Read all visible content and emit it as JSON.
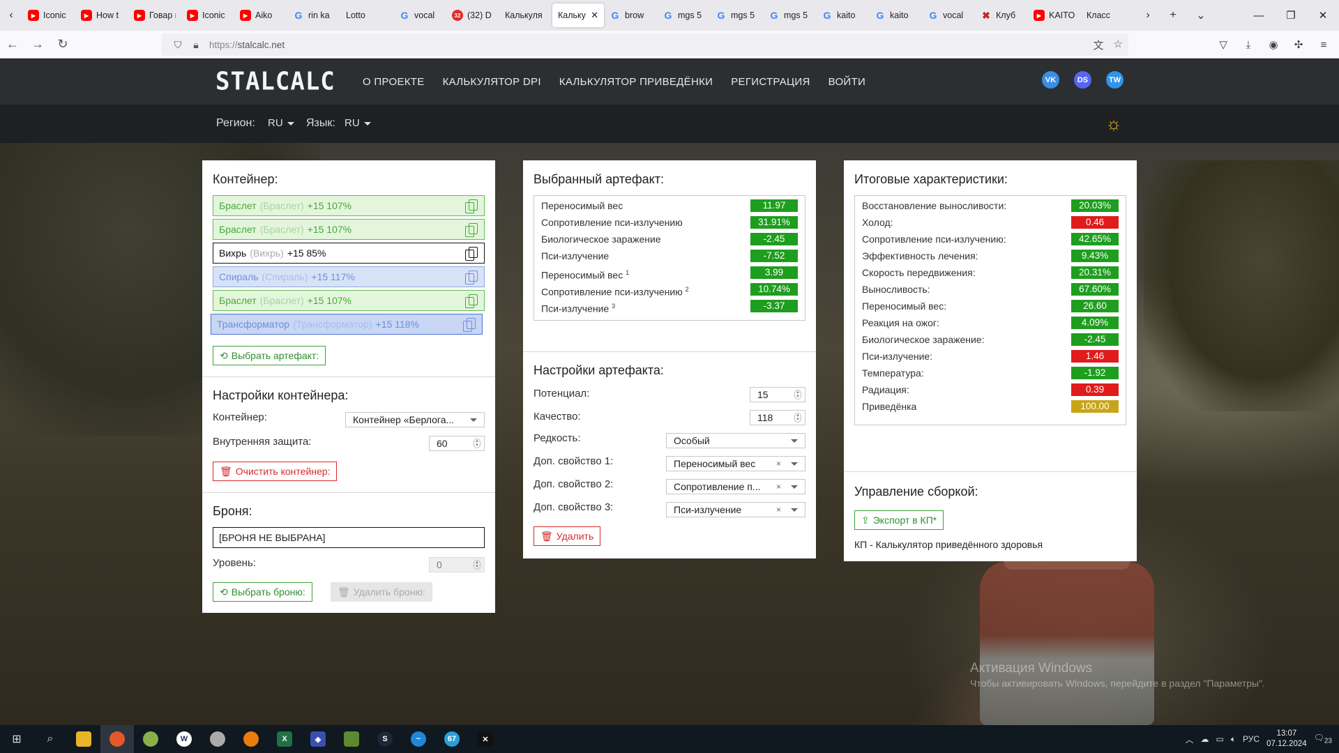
{
  "browser": {
    "tabs": [
      {
        "icon": "yt",
        "title": "Iconic"
      },
      {
        "icon": "yt",
        "title": "How t"
      },
      {
        "icon": "yt",
        "title": "Говар воспр"
      },
      {
        "icon": "yt",
        "title": "Iconic"
      },
      {
        "icon": "yt",
        "title": "Aiko"
      },
      {
        "icon": "g",
        "title": "rin ka"
      },
      {
        "icon": "none",
        "title": "Lotto"
      },
      {
        "icon": "g",
        "title": "vocal"
      },
      {
        "icon": "badge",
        "title": "(32) D"
      },
      {
        "icon": "none",
        "title": "Калькуля"
      },
      {
        "icon": "none",
        "title": "Кальку",
        "active": true
      },
      {
        "icon": "g",
        "title": "brow"
      },
      {
        "icon": "g",
        "title": "mgs 5"
      },
      {
        "icon": "g",
        "title": "mgs 5"
      },
      {
        "icon": "g",
        "title": "mgs 5"
      },
      {
        "icon": "g",
        "title": "kaito"
      },
      {
        "icon": "g",
        "title": "kaito"
      },
      {
        "icon": "g",
        "title": "vocal"
      },
      {
        "icon": "x",
        "title": "Клуб"
      },
      {
        "icon": "yt",
        "title": "KAITO"
      },
      {
        "icon": "none",
        "title": "Класс"
      }
    ],
    "url_prefix": "https://",
    "url_host": "stalcalc.net"
  },
  "site": {
    "logo": "STALCALC",
    "nav": [
      "О ПРОЕКТЕ",
      "КАЛЬКУЛЯТОР DPI",
      "КАЛЬКУЛЯТОР ПРИВЕДЁНКИ",
      "РЕГИСТРАЦИЯ",
      "ВОЙТИ"
    ],
    "socials": {
      "vk": "VK",
      "discord": "DS",
      "twitter": "TW"
    },
    "region_label": "Регион:",
    "region_value": "RU",
    "lang_label": "Язык:",
    "lang_value": "RU"
  },
  "container_panel": {
    "title": "Контейнер:",
    "slots": [
      {
        "name": "Браслет",
        "base": "(Браслет)",
        "ext": "+15 107%",
        "style": "green"
      },
      {
        "name": "Браслет",
        "base": "(Браслет)",
        "ext": "+15 107%",
        "style": "green"
      },
      {
        "name": "Вихрь",
        "base": "(Вихрь)",
        "ext": "+15 85%",
        "style": "black"
      },
      {
        "name": "Спираль",
        "base": "(Спираль)",
        "ext": "+15 117%",
        "style": "blue"
      },
      {
        "name": "Браслет",
        "base": "(Браслет)",
        "ext": "+15 107%",
        "style": "green"
      },
      {
        "name": "Трансформатор",
        "base": "(Трансформатор)",
        "ext": "+15 118%",
        "style": "blue sel"
      }
    ],
    "choose_artifact": "Выбрать артефакт:",
    "settings_title": "Настройки контейнера:",
    "container_label": "Контейнер:",
    "container_value": "Контейнер «Берлога...",
    "inner_protection_label": "Внутренняя защита:",
    "inner_protection_value": "60",
    "clear_container": "Очистить контейнер:",
    "armor_title": "Броня:",
    "armor_value": "[БРОНЯ НЕ ВЫБРАНА]",
    "level_label": "Уровень:",
    "level_value": "0",
    "choose_armor": "Выбрать броню:",
    "delete_armor": "Удалить броню:"
  },
  "artifact_panel": {
    "title": "Выбранный артефакт:",
    "stats": [
      {
        "label": "Переносимый вес",
        "sup": "",
        "value": "11.97",
        "color": "#1e9e1e"
      },
      {
        "label": "Сопротивление пси-излучению",
        "sup": "",
        "value": "31.91%",
        "color": "#1e9e1e"
      },
      {
        "label": "Биологическое заражение",
        "sup": "",
        "value": "-2.45",
        "color": "#1e9e1e"
      },
      {
        "label": "Пси-излучение",
        "sup": "",
        "value": "-7.52",
        "color": "#1e9e1e"
      },
      {
        "label": "Переносимый вес",
        "sup": "1",
        "value": "3.99",
        "color": "#1e9e1e"
      },
      {
        "label": "Сопротивление пси-излучению",
        "sup": "2",
        "value": "10.74%",
        "color": "#1e9e1e"
      },
      {
        "label": "Пси-излучение",
        "sup": "3",
        "value": "-3.37",
        "color": "#1e9e1e"
      }
    ],
    "settings_title": "Настройки артефакта:",
    "potential_label": "Потенциал:",
    "potential_value": "15",
    "quality_label": "Качество:",
    "quality_value": "118",
    "rarity_label": "Редкость:",
    "rarity_value": "Особый",
    "extra1_label": "Доп. свойство 1:",
    "extra1_value": "Переносимый вес",
    "extra2_label": "Доп. свойство 2:",
    "extra2_value": "Сопротивление п...",
    "extra3_label": "Доп. свойство 3:",
    "extra3_value": "Пси-излучение",
    "delete": "Удалить"
  },
  "result_panel": {
    "title": "Итоговые характеристики:",
    "stats": [
      {
        "label": "Восстановление выносливости:",
        "value": "20.03%",
        "color": "#1e9e1e"
      },
      {
        "label": "Холод:",
        "value": "0.46",
        "color": "#e01b1b"
      },
      {
        "label": "Сопротивление пси-излучению:",
        "value": "42.65%",
        "color": "#1e9e1e"
      },
      {
        "label": "Эффективность лечения:",
        "value": "9.43%",
        "color": "#1e9e1e"
      },
      {
        "label": "Скорость передвижения:",
        "value": "20.31%",
        "color": "#1e9e1e"
      },
      {
        "label": "Выносливость:",
        "value": "67.60%",
        "color": "#1e9e1e"
      },
      {
        "label": "Переносимый вес:",
        "value": "26.60",
        "color": "#1e9e1e"
      },
      {
        "label": "Реакция на ожог:",
        "value": "4.09%",
        "color": "#1e9e1e"
      },
      {
        "label": "Биологическое заражение:",
        "value": "-2.45",
        "color": "#1e9e1e"
      },
      {
        "label": "Пси-излучение:",
        "value": "1.46",
        "color": "#e01b1b"
      },
      {
        "label": "Температура:",
        "value": "-1.92",
        "color": "#1e9e1e"
      },
      {
        "label": "Радиация:",
        "value": "0.39",
        "color": "#e01b1b"
      },
      {
        "label": "Приведёнка",
        "value": "100.00",
        "color": "#c9a417"
      }
    ],
    "manage_title": "Управление сборкой:",
    "export": "Экспорт в КП*",
    "footnote": "КП - Калькулятор приведённого здоровья"
  },
  "watermark": {
    "line1": "Активация Windows",
    "line2": "Чтобы активировать Windows, перейдите в раздел \"Параметры\"."
  },
  "taskbar": {
    "lang": "РУС",
    "time": "13:07",
    "date": "07.12.2024",
    "notif": "23",
    "telegram_badge": "67"
  }
}
